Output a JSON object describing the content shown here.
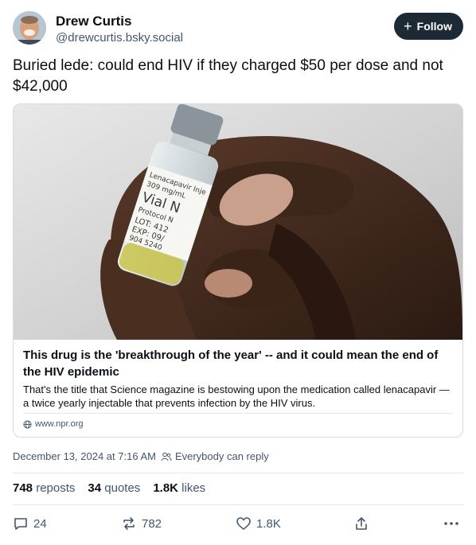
{
  "author": {
    "name": "Drew Curtis",
    "handle": "@drewcurtis.bsky.social",
    "follow_label": "Follow"
  },
  "post": {
    "text": "Buried lede: could end HIV if they charged $50 per dose and not $42,000"
  },
  "link_card": {
    "title": "This drug is the 'breakthrough of the year' -- and it could mean the end of the HIV epidemic",
    "description": "That's the title that Science magazine is bestowing upon the medication called lenacapavir — a twice yearly injectable that prevents infection by the HIV virus.",
    "domain": "www.npr.org",
    "image_alt": "Hand holding a vial of lenacapavir",
    "vial_label": {
      "line1": "Lenacapavir Inje",
      "line2": "309 mg/mL",
      "line3": "Vial N",
      "line4": "Protocol N",
      "line5": "LOT: 412",
      "line6": "EXP: 09/",
      "line7": "904 5240"
    }
  },
  "meta": {
    "timestamp": "December 13, 2024 at 7:16 AM",
    "reply_setting": "Everybody can reply"
  },
  "stats": {
    "reposts_count": "748",
    "reposts_label": "reposts",
    "quotes_count": "34",
    "quotes_label": "quotes",
    "likes_count": "1.8K",
    "likes_label": "likes"
  },
  "actions": {
    "reply_count": "24",
    "repost_count": "782",
    "like_count": "1.8K"
  },
  "colors": {
    "text_primary": "#0b0f14",
    "text_secondary": "#42576c",
    "follow_bg": "#1e2936",
    "border": "#d4dbe2"
  }
}
